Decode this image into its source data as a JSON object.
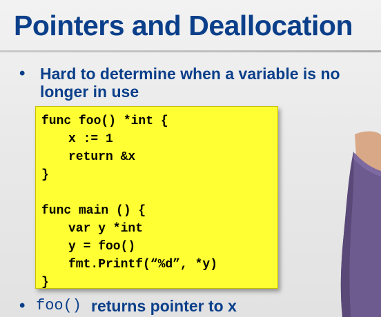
{
  "slide": {
    "title": "Pointers and Deallocation",
    "bullets": [
      {
        "text": "Hard to determine when a variable is no longer in use"
      },
      {
        "code": "foo()",
        "text": "returns pointer to x"
      }
    ],
    "code_lines": [
      "func foo() *int {",
      "x := 1",
      "return &x",
      "}",
      "",
      "func main () {",
      "var y *int",
      "y = foo()",
      "fmt.Printf(“%d”, *y)",
      "}"
    ]
  },
  "colors": {
    "title": "#0b3f8a",
    "code_box_bg": "#ffff33",
    "slide_bg": "#ebebeb",
    "presenter_shirt": "#6d5a8f",
    "presenter_skin": "#d9a887"
  }
}
